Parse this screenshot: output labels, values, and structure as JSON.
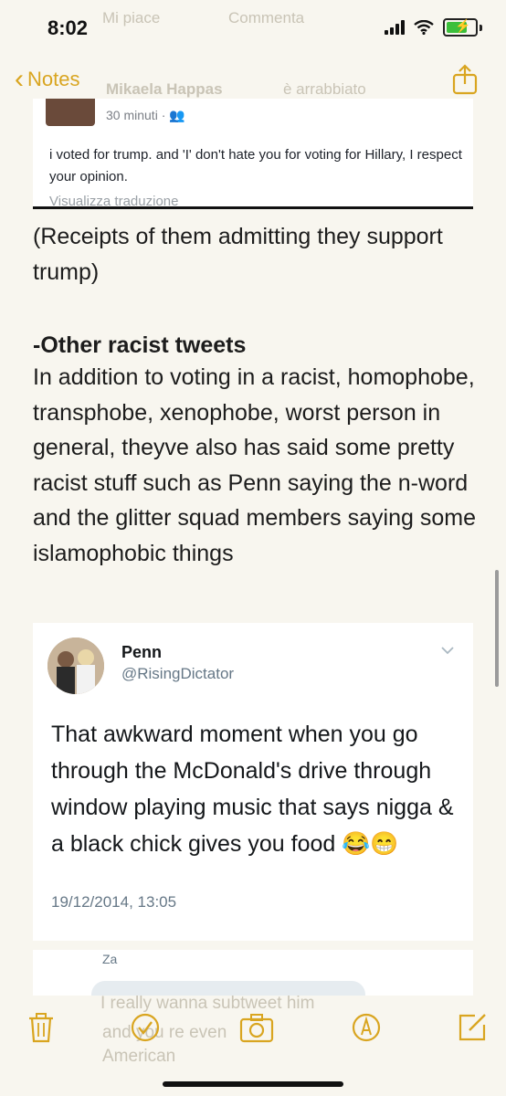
{
  "status_bar": {
    "time": "8:02"
  },
  "nav": {
    "back_label": "Notes"
  },
  "background_ghost": {
    "top_left": "Mi piace",
    "top_mid": "Commenta",
    "poster": "Mikaela Happas",
    "poster_status": "è arrabbiato"
  },
  "fb_post": {
    "time": "30 minuti ·",
    "text": "i voted for trump. and 'I' don't hate you for voting for Hillary, I respect your opinion.",
    "translate": "Visualizza traduzione"
  },
  "note": {
    "receipts": "(Receipts of them admitting they support trump)",
    "heading": "-Other racist tweets",
    "paragraph": "In addition to voting in a racist, homophobe, transphobe, xenophobe, worst person in general, theyve also has said some pretty racist stuff such as Penn saying the n-word and the glitter squad members saying some islamophobic things"
  },
  "tweet": {
    "name": "Penn",
    "handle": "@RisingDictator",
    "text": "That awkward moment when you go through the McDonald's drive through window playing music that says nigga & a black chick gives you food 😂😁",
    "date": "19/12/2014, 13:05"
  },
  "bottom_snippet": {
    "name": "Za",
    "ghost_line1": "I really wanna subtweet him",
    "ghost_line2": "and you re even",
    "ghost_line3": "American"
  },
  "toolbar": {
    "icons": [
      "trash-icon",
      "checklist-icon",
      "camera-icon",
      "markup-icon",
      "compose-icon"
    ]
  },
  "colors": {
    "accent": "#d9a520",
    "paper": "#f8f6ef",
    "text": "#1c1c1c",
    "twitter_gray": "#657786"
  }
}
